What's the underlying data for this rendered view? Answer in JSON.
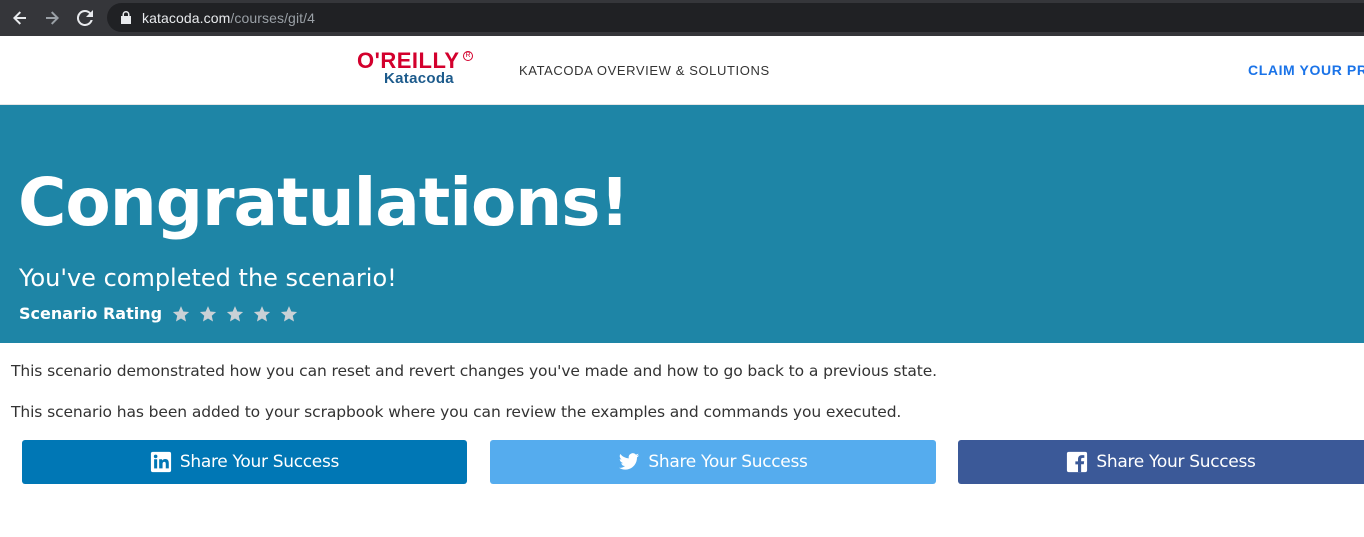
{
  "browser": {
    "url_host": "katacoda.com",
    "url_path": "/courses/git/4",
    "icons": [
      "back-arrow-icon",
      "forward-arrow-icon",
      "reload-icon",
      "lock-icon"
    ]
  },
  "header": {
    "logo_primary": "O'REILLY",
    "logo_secondary": "Katacoda",
    "nav_overview": "KATACODA OVERVIEW & SOLUTIONS",
    "nav_claim": "CLAIM YOUR PRO"
  },
  "hero": {
    "title": "Congratulations!",
    "subtitle": "You've completed the scenario!",
    "rating_label": "Scenario Rating",
    "rating_max": 5,
    "rating_value": 0
  },
  "content": {
    "paragraph_1": "This scenario demonstrated how you can reset and revert changes you've made and how to go back to a previous state.",
    "paragraph_2": "This scenario has been added to your scrapbook where you can review the examples and commands you executed."
  },
  "share": [
    {
      "network": "linkedin",
      "label": "Share Your Success",
      "icon": "linkedin-icon",
      "color": "#0077b5"
    },
    {
      "network": "twitter",
      "label": "Share Your Success",
      "icon": "twitter-icon",
      "color": "#55acee"
    },
    {
      "network": "facebook",
      "label": "Share Your Success",
      "icon": "facebook-icon",
      "color": "#3b5998"
    }
  ],
  "colors": {
    "hero_bg": "#1e85a6",
    "brand_red": "#d3002d",
    "brand_blue": "#1d5b8c",
    "link_blue": "#1a73e8",
    "star_grey": "#c9d1d6"
  }
}
